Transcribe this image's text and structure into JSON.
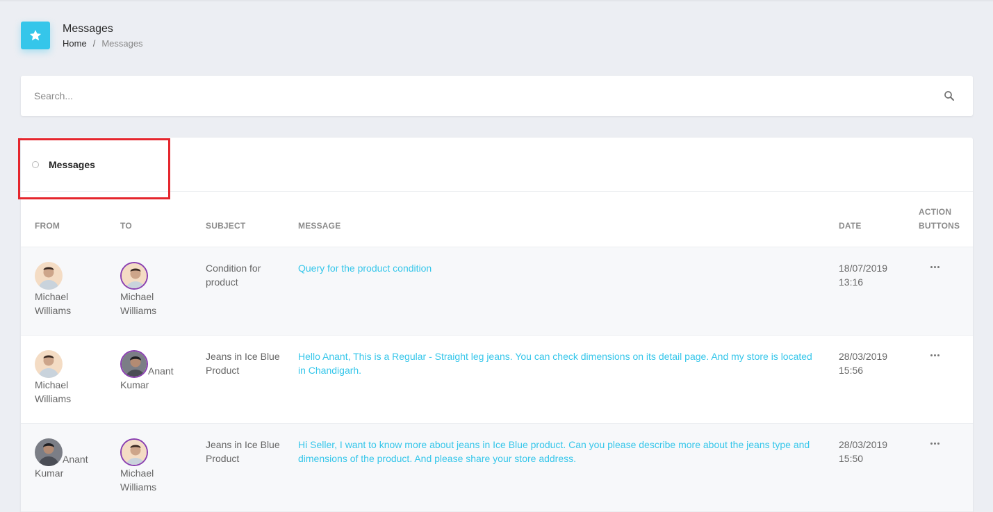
{
  "header": {
    "title": "Messages",
    "breadcrumb": {
      "home": "Home",
      "separator": "/",
      "current": "Messages"
    },
    "icon": "star-icon",
    "accent_color": "#35c6ea"
  },
  "search": {
    "placeholder": "Search...",
    "value": ""
  },
  "card": {
    "title": "Messages"
  },
  "table": {
    "headers": {
      "from": "FROM",
      "to": "TO",
      "subject": "SUBJECT",
      "message": "MESSAGE",
      "date": "DATE",
      "action_line1": "ACTION",
      "action_line2": "BUTTONS"
    },
    "rows": [
      {
        "from": "Michael Williams",
        "to": "Michael Williams",
        "subject": "Condition for product",
        "message": "Query for the product condition",
        "date": "18/07/2019",
        "time": "13:16"
      },
      {
        "from": "Michael Williams",
        "to": "Anant Kumar",
        "subject": "Jeans in Ice Blue Product",
        "message": "Hello Anant, This is a Regular - Straight leg jeans. You can check dimensions on its detail page. And my store is located in Chandigarh.",
        "date": "28/03/2019",
        "time": "15:56"
      },
      {
        "from": "Anant Kumar",
        "to": "Michael Williams",
        "subject": "Jeans in Ice Blue Product",
        "message": "Hi Seller, I want to know more about jeans in Ice Blue product. Can you please describe more about the jeans type and dimensions of the product. And please share your store address.",
        "date": "28/03/2019",
        "time": "15:50"
      }
    ]
  }
}
